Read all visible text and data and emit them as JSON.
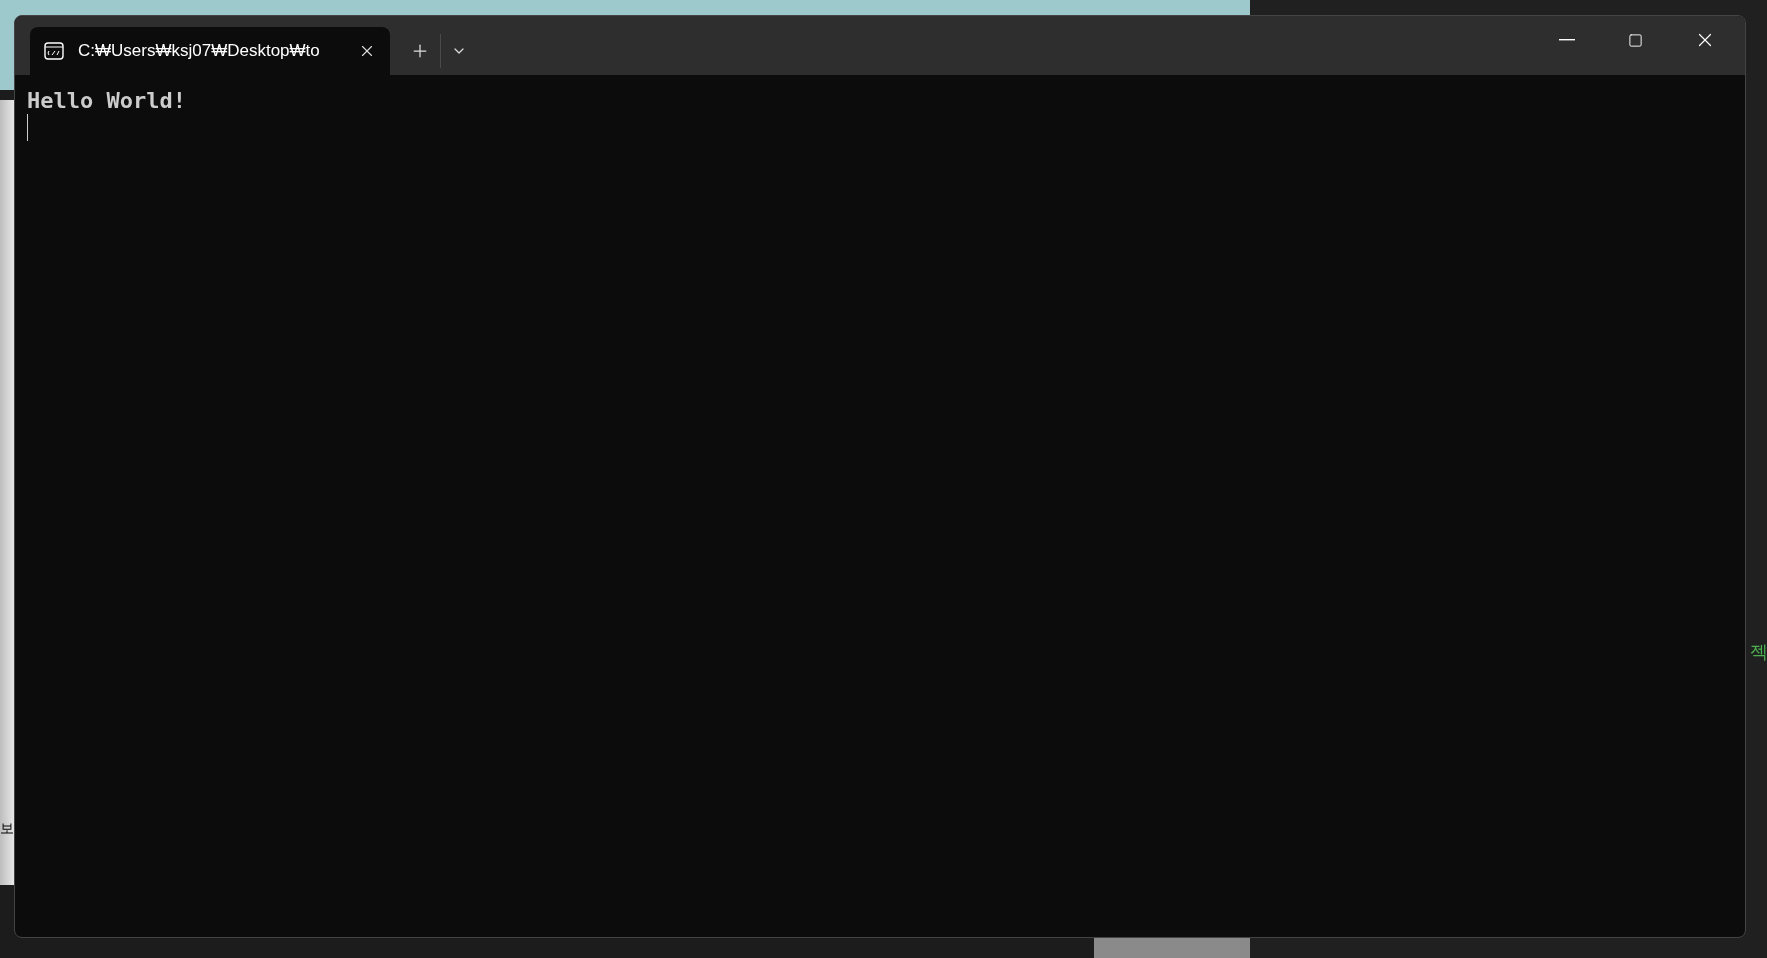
{
  "background": {
    "left_text": "보",
    "right_text": "젝"
  },
  "window": {
    "tabs": [
      {
        "title": "C:₩Users₩ksj07₩Desktop₩to",
        "selected": true
      }
    ]
  },
  "terminal": {
    "lines": [
      "Hello World!"
    ],
    "cursor": true
  }
}
